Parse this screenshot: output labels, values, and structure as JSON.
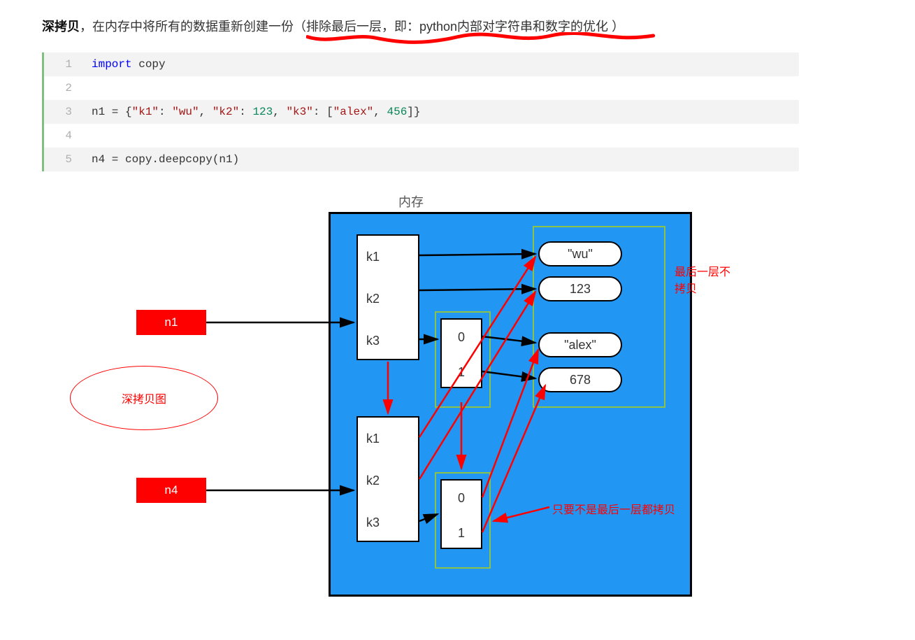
{
  "intro": {
    "bold": "深拷贝",
    "plain1": "，在内存中将所有的数据重新创建一份（",
    "underlined": "排除最后一层，即：python内部对字符串和数字的优化",
    "plain2": "）"
  },
  "code": {
    "lines": [
      {
        "n": "1",
        "shade": true,
        "tokens": [
          {
            "t": "import",
            "c": "kw"
          },
          {
            "t": " copy",
            "c": ""
          }
        ]
      },
      {
        "n": "2",
        "shade": false,
        "tokens": []
      },
      {
        "n": "3",
        "shade": true,
        "tokens": [
          {
            "t": "n1 = {",
            "c": ""
          },
          {
            "t": "\"k1\"",
            "c": "str"
          },
          {
            "t": ": ",
            "c": ""
          },
          {
            "t": "\"wu\"",
            "c": "str"
          },
          {
            "t": ", ",
            "c": ""
          },
          {
            "t": "\"k2\"",
            "c": "str"
          },
          {
            "t": ": ",
            "c": ""
          },
          {
            "t": "123",
            "c": "num"
          },
          {
            "t": ", ",
            "c": ""
          },
          {
            "t": "\"k3\"",
            "c": "str"
          },
          {
            "t": ": [",
            "c": ""
          },
          {
            "t": "\"alex\"",
            "c": "str"
          },
          {
            "t": ", ",
            "c": ""
          },
          {
            "t": "456",
            "c": "num"
          },
          {
            "t": "]}",
            "c": ""
          }
        ]
      },
      {
        "n": "4",
        "shade": false,
        "tokens": []
      },
      {
        "n": "5",
        "shade": true,
        "tokens": [
          {
            "t": "n4 = copy.deepcopy(n1)",
            "c": ""
          }
        ]
      }
    ]
  },
  "diagram": {
    "mem_title": "内存",
    "var_n1": "n1",
    "var_n4": "n4",
    "dict": {
      "k1": "k1",
      "k2": "k2",
      "k3": "k3"
    },
    "list": {
      "i0": "0",
      "i1": "1"
    },
    "pills": {
      "wu": "\"wu\"",
      "p123": "123",
      "alex": "\"alex\"",
      "p678": "678"
    },
    "ellipse": "深拷贝图",
    "ann_right": "最后一层不拷贝",
    "ann_bottom": "只要不是最后一层都拷贝"
  }
}
